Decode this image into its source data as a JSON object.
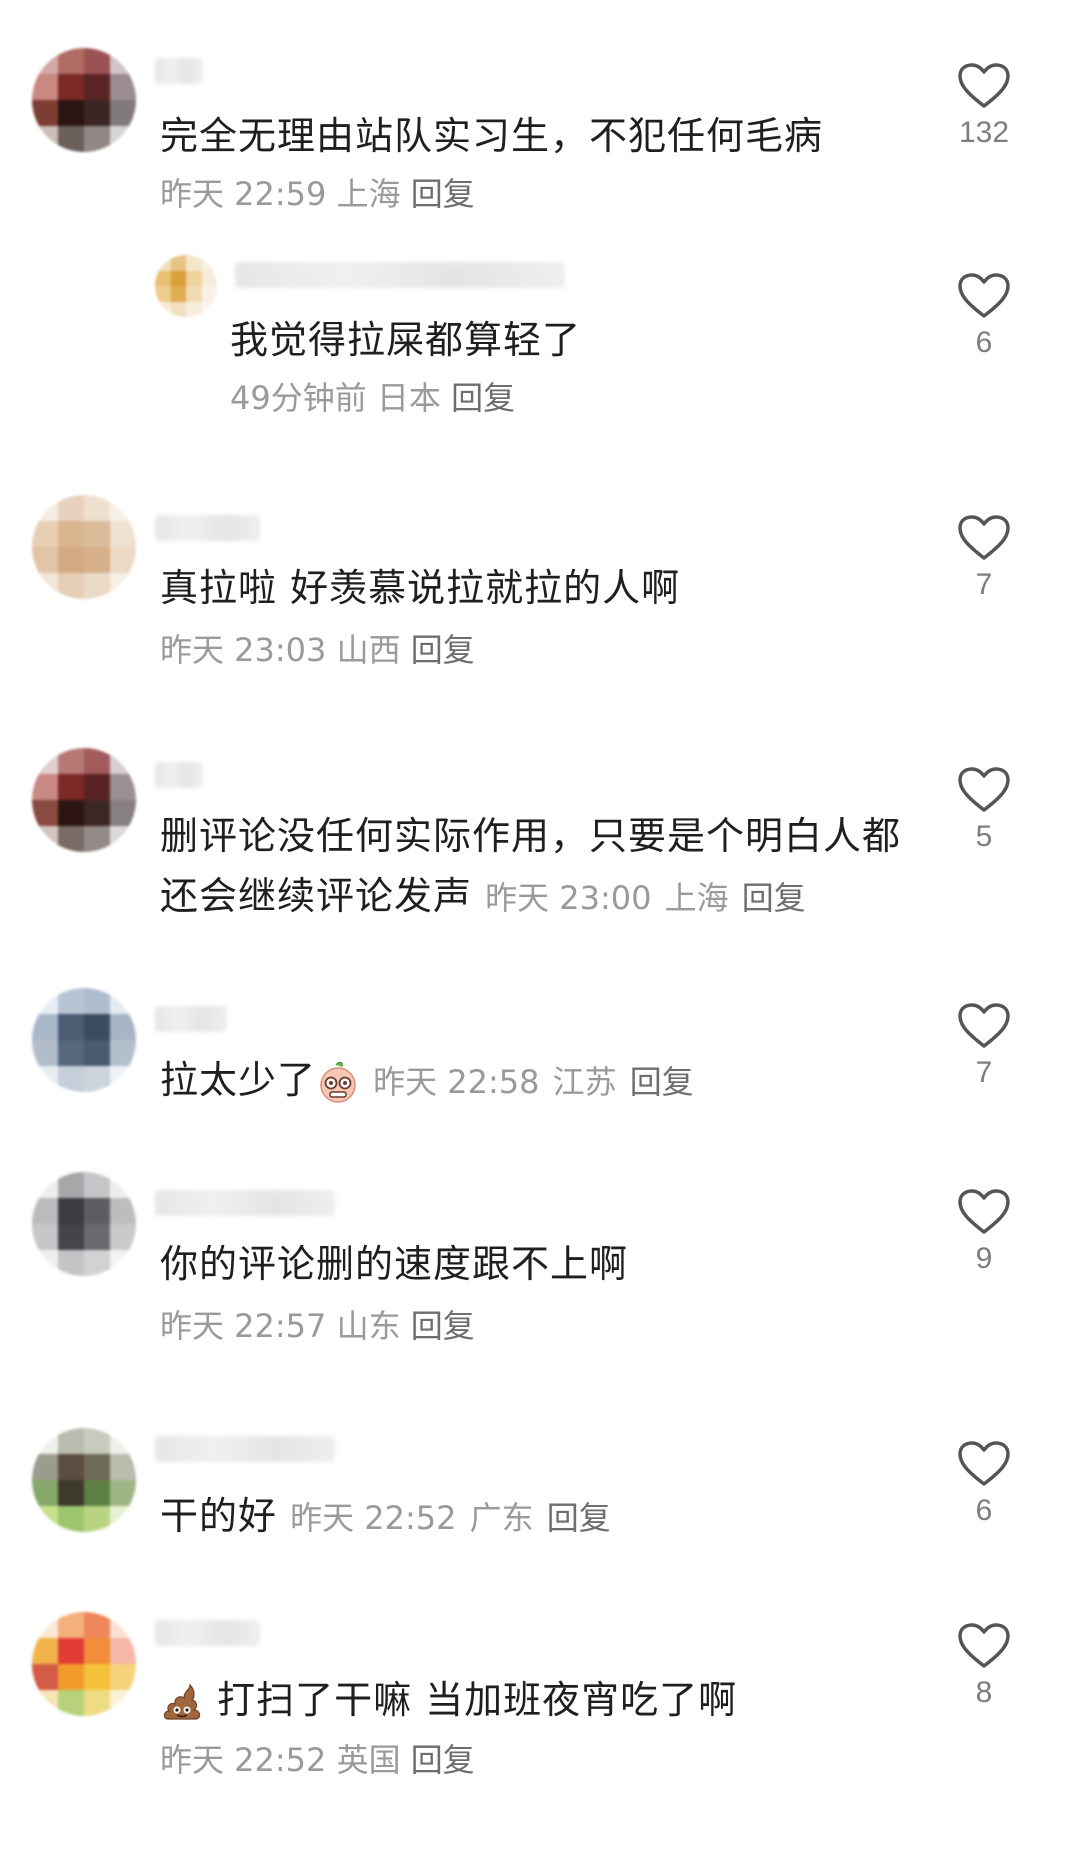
{
  "comments": [
    {
      "text": "完全无理由站队实习生，不犯任何毛病",
      "time": "昨天 22:59",
      "location": "上海",
      "reply": "回复",
      "likes": "132"
    },
    {
      "text": "我觉得拉屎都算轻了",
      "time": "49分钟前",
      "location": "日本",
      "reply": "回复",
      "likes": "6"
    },
    {
      "text": "真拉啦 好羡慕说拉就拉的人啊",
      "time": "昨天 23:03",
      "location": "山西",
      "reply": "回复",
      "likes": "7"
    },
    {
      "text_line1": "删评论没任何实际作用，只要是个明白人都",
      "text_line2": "还会继续评论发声",
      "time": "昨天 23:00",
      "location": "上海",
      "reply": "回复",
      "likes": "5"
    },
    {
      "text": "拉太少了",
      "emoji": "grimace-face-emoji",
      "time": "昨天 22:58",
      "location": "江苏",
      "reply": "回复",
      "likes": "7"
    },
    {
      "text": "你的评论删的速度跟不上啊",
      "time": "昨天 22:57",
      "location": "山东",
      "reply": "回复",
      "likes": "9"
    },
    {
      "text": "干的好",
      "time": "昨天 22:52",
      "location": "广东",
      "reply": "回复",
      "likes": "6"
    },
    {
      "text": "打扫了干嘛 当加班夜宵吃了啊",
      "emoji": "poop-emoji",
      "time": "昨天 22:52",
      "location": "英国",
      "reply": "回复",
      "likes": "8"
    }
  ],
  "icons": {
    "like": "heart-outline-icon"
  },
  "colors": {
    "text": "#1f1f1f",
    "meta": "#9a9a9a",
    "icon": "#555555"
  }
}
